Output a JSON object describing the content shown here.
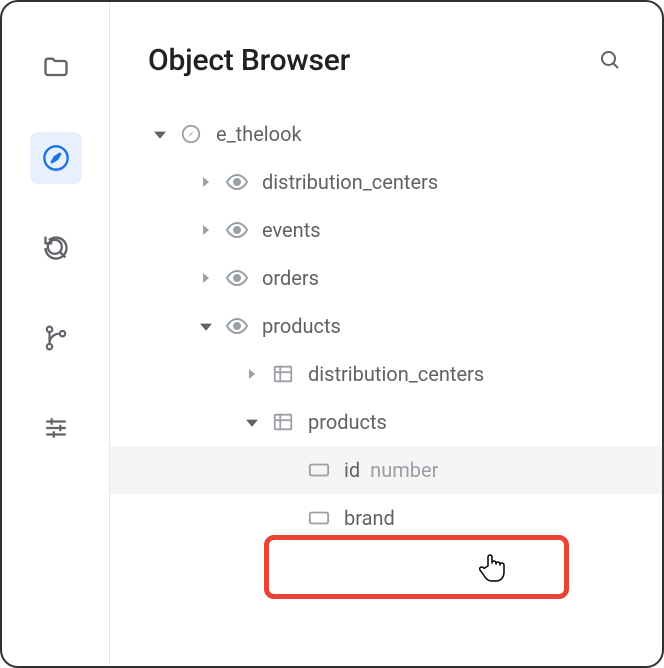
{
  "header": {
    "title": "Object Browser"
  },
  "rail": {
    "items": [
      "folder",
      "compass",
      "history",
      "branch",
      "sliders"
    ],
    "active": "compass"
  },
  "tree": {
    "root": {
      "label": "e_thelook",
      "children": [
        {
          "label": "distribution_centers"
        },
        {
          "label": "events"
        },
        {
          "label": "orders"
        },
        {
          "label": "products",
          "children": [
            {
              "label": "distribution_centers"
            },
            {
              "label": "products",
              "fields": [
                {
                  "label": "id",
                  "type": "number"
                },
                {
                  "label": "brand"
                }
              ]
            }
          ]
        }
      ]
    }
  }
}
